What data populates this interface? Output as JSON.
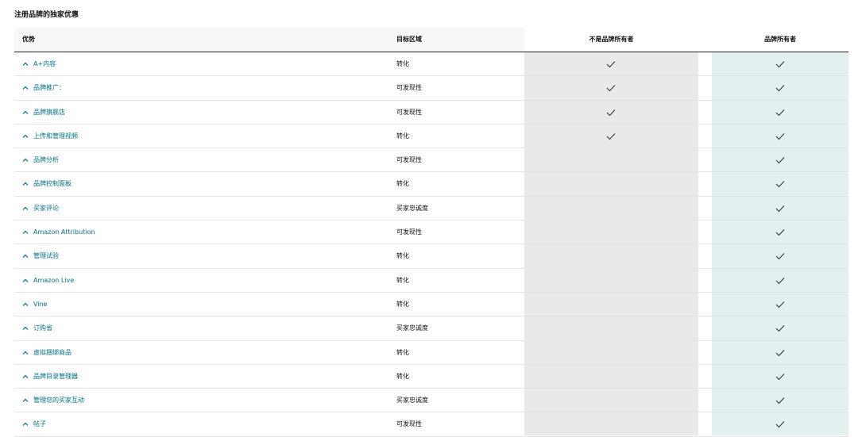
{
  "page_title": "注册品牌的独家优惠",
  "table": {
    "headers": {
      "benefit": "优势",
      "target": "目标区域",
      "non_owner": "不是品牌所有者",
      "owner": "品牌所有者"
    },
    "rows": [
      {
        "benefit": "A+内容",
        "target": "转化",
        "non_owner": true,
        "owner": true
      },
      {
        "benefit": "品牌推广：",
        "target": "可发现性",
        "non_owner": true,
        "owner": true
      },
      {
        "benefit": "品牌旗舰店",
        "target": "可发现性",
        "non_owner": true,
        "owner": true
      },
      {
        "benefit": "上传和管理视频",
        "target": "转化",
        "non_owner": true,
        "owner": true
      },
      {
        "benefit": "品牌分析",
        "target": "可发现性",
        "non_owner": false,
        "owner": true
      },
      {
        "benefit": "品牌控制面板",
        "target": "转化",
        "non_owner": false,
        "owner": true
      },
      {
        "benefit": "买家评论",
        "target": "买家忠诚度",
        "non_owner": false,
        "owner": true
      },
      {
        "benefit": "Amazon Attribution",
        "target": "可发现性",
        "non_owner": false,
        "owner": true
      },
      {
        "benefit": "管理试验",
        "target": "转化",
        "non_owner": false,
        "owner": true
      },
      {
        "benefit": "Amazon Live",
        "target": "转化",
        "non_owner": false,
        "owner": true
      },
      {
        "benefit": "Vine",
        "target": "转化",
        "non_owner": false,
        "owner": true
      },
      {
        "benefit": "订购省",
        "target": "买家忠诚度",
        "non_owner": false,
        "owner": true
      },
      {
        "benefit": "虚拟捆绑商品",
        "target": "转化",
        "non_owner": false,
        "owner": true
      },
      {
        "benefit": "品牌目录管理器",
        "target": "转化",
        "non_owner": false,
        "owner": true
      },
      {
        "benefit": "管理您的买家互动",
        "target": "买家忠诚度",
        "non_owner": false,
        "owner": true
      },
      {
        "benefit": "帖子",
        "target": "可发现性",
        "non_owner": false,
        "owner": true
      }
    ]
  },
  "icons": {
    "expand": "chevron-up-icon",
    "check": "checkmark-icon"
  },
  "colors": {
    "link": "#007185",
    "non_owner_column": "#e8e9ea",
    "owner_column": "#e4f0f0"
  }
}
